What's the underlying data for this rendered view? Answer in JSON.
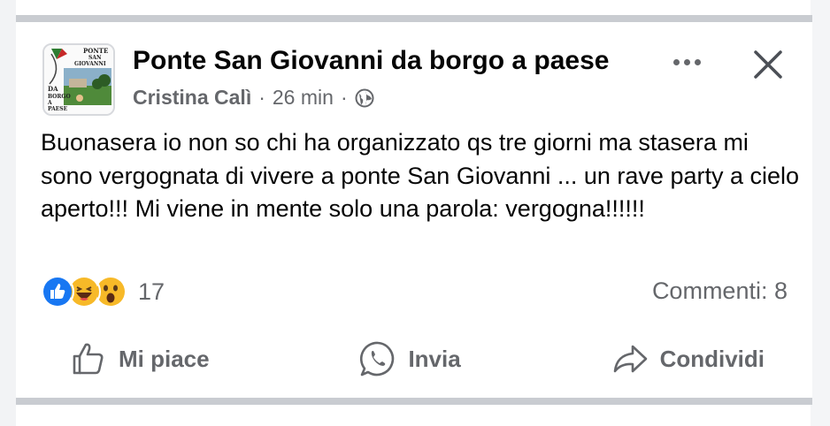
{
  "post": {
    "group_name": "Ponte San Giovanni da borgo a paese",
    "author": "Cristina Calì",
    "separator": "·",
    "time": "26 min",
    "audience_icon": "globe-icon",
    "text": "Buonasera io non so chi ha organizzato qs tre giorni ma stasera mi sono vergognata di vivere a ponte San Giovanni ... un rave party a cielo aperto!!! Mi viene in mente solo una parola: vergogna!!!!!!",
    "avatar_text": [
      "PONTE",
      "SAN",
      "GIOVANNI",
      "DA",
      "BORGO",
      "A PAESE"
    ]
  },
  "reactions": {
    "icons": [
      "like-reaction-icon",
      "haha-reaction-icon",
      "wow-reaction-icon"
    ],
    "count": "17"
  },
  "comments_label": "Commenti: 8",
  "actions": {
    "like": "Mi piace",
    "send": "Invia",
    "share": "Condividi"
  },
  "colors": {
    "text_primary": "#050505",
    "text_secondary": "#65676b",
    "like_blue": "#1877f2",
    "emoji_yellow": "#f7b928",
    "divider": "#c9ccd1"
  }
}
